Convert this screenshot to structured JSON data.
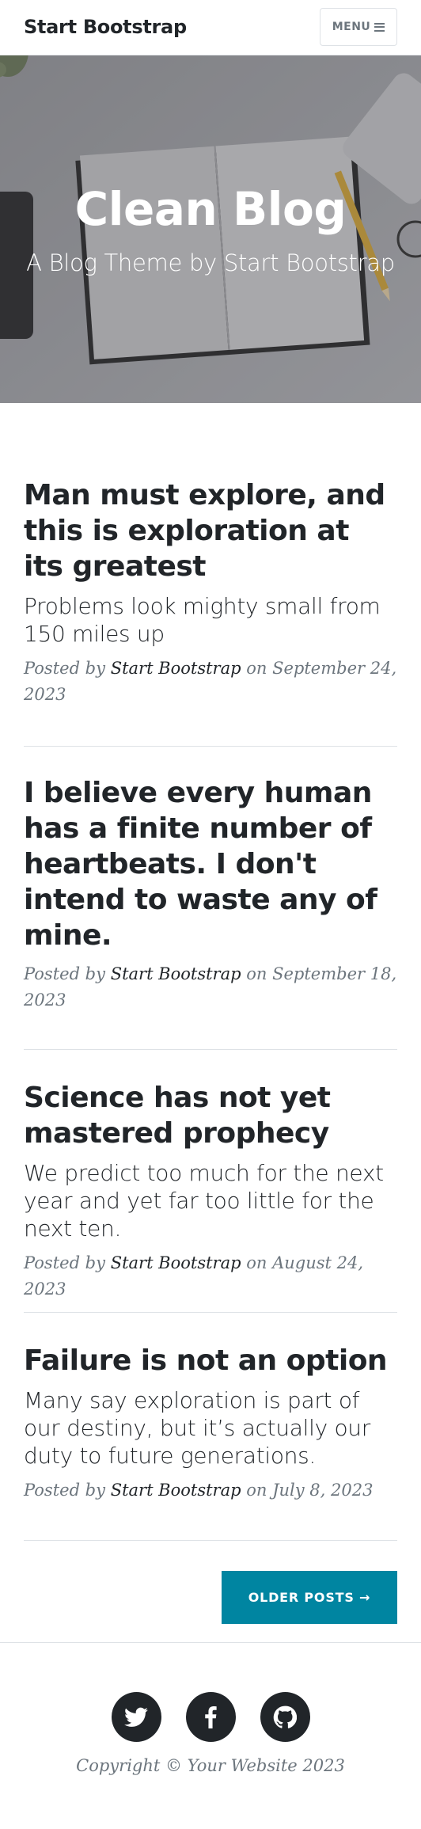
{
  "navbar": {
    "brand": "Start Bootstrap",
    "menu_label": "MENU"
  },
  "hero": {
    "title": "Clean Blog",
    "subtitle": "A Blog Theme by Start Bootstrap"
  },
  "posts": [
    {
      "title": "Man must explore, and this is exploration at its greatest",
      "subtitle": "Problems look mighty small from 150 miles up",
      "posted_by": "Posted by",
      "author": "Start Bootstrap",
      "on": "on",
      "date": "September 24, 2023"
    },
    {
      "title": "I believe every human has a finite number of heartbeats. I don't intend to waste any of mine.",
      "subtitle": "",
      "posted_by": "Posted by",
      "author": "Start Bootstrap",
      "on": "on",
      "date": "September 18, 2023"
    },
    {
      "title": "Science has not yet mastered prophecy",
      "subtitle": "We predict too much for the next year and yet far too little for the next ten.",
      "posted_by": "Posted by",
      "author": "Start Bootstrap",
      "on": "on",
      "date": "August 24, 2023"
    },
    {
      "title": "Failure is not an option",
      "subtitle": "Many say exploration is part of our destiny, but it’s actually our duty to future generations.",
      "posted_by": "Posted by",
      "author": "Start Bootstrap",
      "on": "on",
      "date": "July 8, 2023"
    }
  ],
  "pagination": {
    "older_label": "OLDER POSTS →"
  },
  "footer": {
    "social_icons": [
      "twitter-icon",
      "facebook-icon",
      "github-icon"
    ],
    "copyright": "Copyright © Your Website 2023"
  },
  "colors": {
    "accent": "#0085a1",
    "text": "#212529",
    "muted": "#6c757d",
    "social_bg": "#212529"
  }
}
